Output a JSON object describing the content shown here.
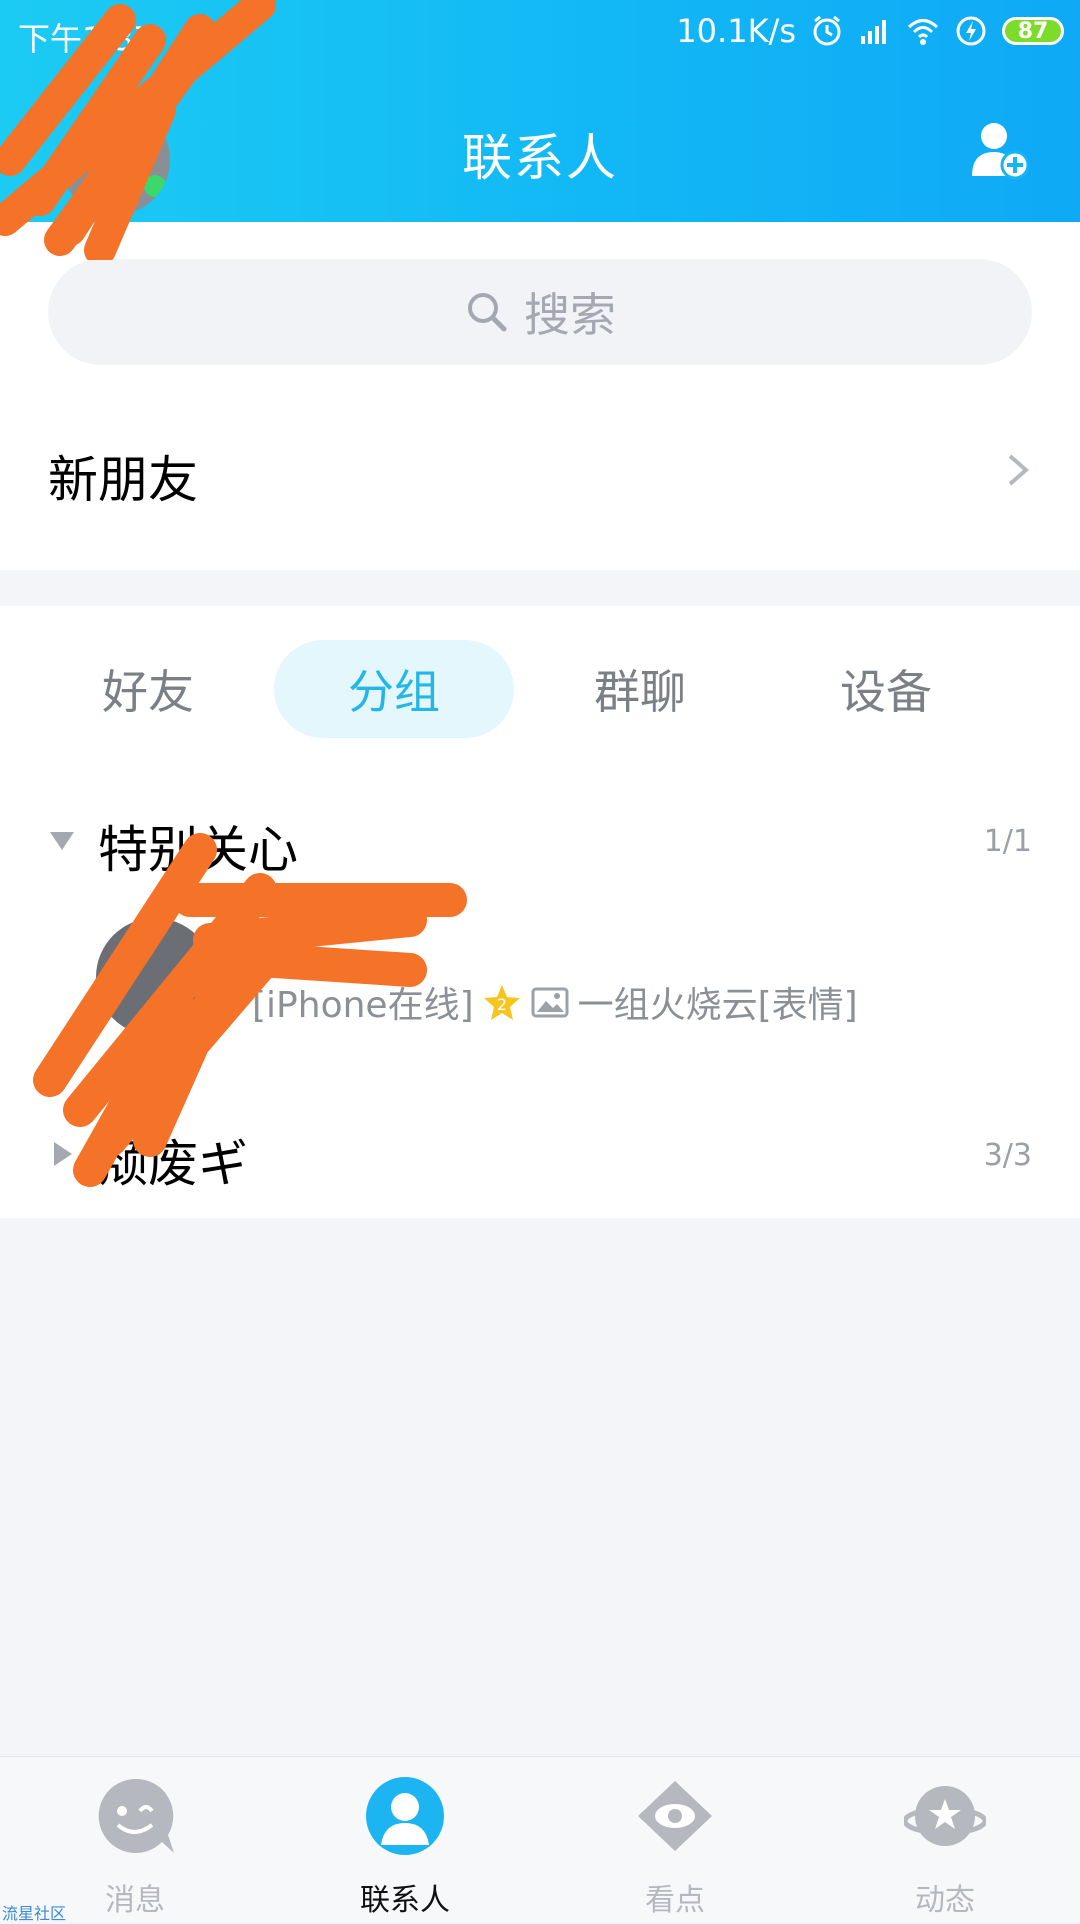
{
  "status_bar": {
    "time": "下午1:37",
    "net_speed": "10.1K/s",
    "battery": "87",
    "icons": [
      "alarm-icon",
      "signal-icon",
      "wifi-icon",
      "charging-icon",
      "battery-icon"
    ]
  },
  "header": {
    "title": "联系人",
    "add_icon": "add-contact-icon"
  },
  "search": {
    "placeholder": "搜索"
  },
  "new_friends": {
    "label": "新朋友"
  },
  "tabs": [
    {
      "label": "好友",
      "active": false
    },
    {
      "label": "分组",
      "active": true
    },
    {
      "label": "群聊",
      "active": false
    },
    {
      "label": "设备",
      "active": false
    }
  ],
  "groups": [
    {
      "name": "特别关心",
      "count": "1/1",
      "expanded": true,
      "contacts": [
        {
          "name": "·掠",
          "status": "[iPhone在线]",
          "signature": "一组火烧云[表情]"
        }
      ]
    },
    {
      "name": "颓废ギ",
      "count": "3/3",
      "expanded": false
    }
  ],
  "tabbar": [
    {
      "label": "消息",
      "icon": "message-icon",
      "active": false
    },
    {
      "label": "联系人",
      "icon": "contacts-icon",
      "active": true
    },
    {
      "label": "看点",
      "icon": "eye-icon",
      "active": false
    },
    {
      "label": "动态",
      "icon": "planet-star-icon",
      "active": false
    }
  ],
  "colors": {
    "accent": "#25b6e8",
    "header_start": "#1ccbf3",
    "header_end": "#0fa9f6",
    "scribble": "#f47328"
  },
  "watermark": "流星社区"
}
